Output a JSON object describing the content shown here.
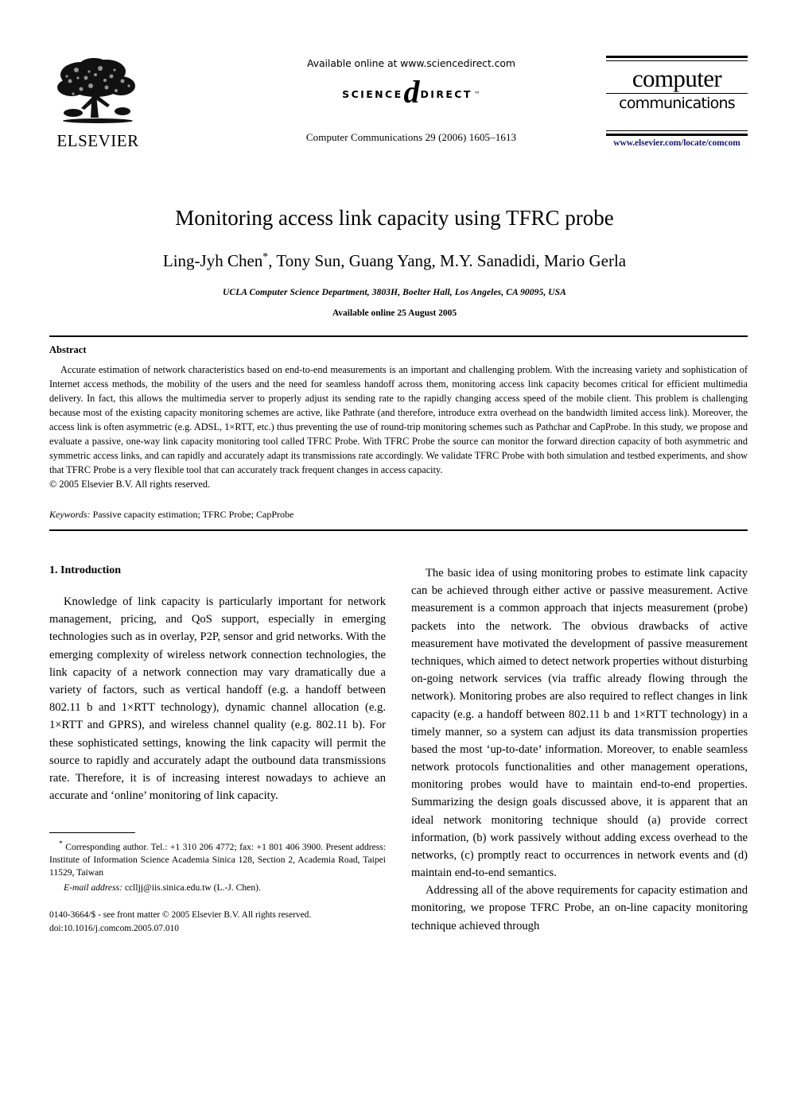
{
  "masthead": {
    "publisher_name": "ELSEVIER",
    "publisher_logo_alt": "elsevier-tree-logo",
    "available_online": "Available online at www.sciencedirect.com",
    "sciencedirect_left": "SCIENCE",
    "sciencedirect_d": "d",
    "sciencedirect_right": "DIRECT",
    "sciencedirect_tm": "™",
    "journal_citation": "Computer Communications 29 (2006) 1605–1613",
    "journal_logo_line1": "computer",
    "journal_logo_line2": "communications",
    "journal_url": "www.elsevier.com/locate/comcom",
    "url_color": "#1b1b6f"
  },
  "title_block": {
    "title": "Monitoring access link capacity using TFRC probe",
    "authors": "Ling-Jyh Chen, Tony Sun, Guang Yang, M.Y. Sanadidi, Mario Gerla",
    "author_first": "Ling-Jyh Chen",
    "author_marker": "*",
    "author_rest": ", Tony Sun, Guang Yang, M.Y. Sanadidi, Mario Gerla",
    "affiliation": "UCLA Computer Science Department, 3803H, Boelter Hall, Los Angeles, CA 90095, USA",
    "available_online_date": "Available online 25 August 2005"
  },
  "abstract": {
    "heading": "Abstract",
    "body": "Accurate estimation of network characteristics based on end-to-end measurements is an important and challenging problem. With the increasing variety and sophistication of Internet access methods, the mobility of the users and the need for seamless handoff across them, monitoring access link capacity becomes critical for efficient multimedia delivery. In fact, this allows the multimedia server to properly adjust its sending rate to the rapidly changing access speed of the mobile client. This problem is challenging because most of the existing capacity monitoring schemes are active, like Pathrate (and therefore, introduce extra overhead on the bandwidth limited access link). Moreover, the access link is often asymmetric (e.g. ADSL, 1×RTT, etc.) thus preventing the use of round-trip monitoring schemes such as Pathchar and CapProbe. In this study, we propose and evaluate a passive, one-way link capacity monitoring tool called TFRC Probe. With TFRC Probe the source can monitor the forward direction capacity of both asymmetric and symmetric access links, and can rapidly and accurately adapt its transmissions rate accordingly. We validate TFRC Probe with both simulation and testbed experiments, and show that TFRC Probe is a very flexible tool that can accurately track frequent changes in access capacity.",
    "copyright": "© 2005 Elsevier B.V. All rights reserved.",
    "keywords_label": "Keywords:",
    "keywords_value": " Passive capacity estimation; TFRC Probe; CapProbe"
  },
  "body": {
    "section_heading": "1. Introduction",
    "left_paragraph_1": "Knowledge of link capacity is particularly important for network management, pricing, and QoS support, especially in emerging technologies such as in overlay, P2P, sensor and grid networks. With the emerging complexity of wireless network connection technologies, the link capacity of a network connection may vary dramatically due a variety of factors, such as vertical handoff (e.g. a handoff between 802.11 b and 1×RTT technology), dynamic channel allocation (e.g. 1×RTT and GPRS), and wireless channel quality (e.g. 802.11 b). For these sophisticated settings, knowing the link capacity will permit the source to rapidly and accurately adapt the outbound data transmissions rate. Therefore, it is of increasing interest nowadays to achieve an accurate and ‘online’ monitoring of link capacity.",
    "right_paragraph_1": "The basic idea of using monitoring probes to estimate link capacity can be achieved through either active or passive measurement. Active measurement is a common approach that injects measurement (probe) packets into the network. The obvious drawbacks of active measurement have motivated the development of passive measurement techniques, which aimed to detect network properties without disturbing on-going network services (via traffic already flowing through the network). Monitoring probes are also required to reflect changes in link capacity (e.g. a handoff between 802.11 b and 1×RTT technology) in a timely manner, so a system can adjust its data transmission properties based the most ‘up-to-date’ information. Moreover, to enable seamless network protocols functionalities and other management operations, monitoring probes would have to maintain end-to-end properties. Summarizing the design goals discussed above, it is apparent that an ideal network monitoring technique should (a) provide correct information, (b) work passively without adding excess overhead to the networks, (c) promptly react to occurrences in network events and (d) maintain end-to-end semantics.",
    "right_paragraph_2": "Addressing all of the above requirements for capacity estimation and monitoring, we propose TFRC Probe, an on-line capacity monitoring technique achieved through"
  },
  "footnote": {
    "marker": "*",
    "corresponding": " Corresponding author. Tel.: +1 310 206 4772; fax: +1 801 406 3900. Present address: Institute of Information Science Academia Sinica 128, Section 2, Academia Road, Taipei 11529, Taiwan",
    "email_label": "E-mail address:",
    "email_value": " cclljj@iis.sinica.edu.tw (L.-J. Chen).",
    "issn_line": "0140-3664/$ - see front matter © 2005 Elsevier B.V. All rights reserved.",
    "doi_line": "doi:10.1016/j.comcom.2005.07.010"
  }
}
